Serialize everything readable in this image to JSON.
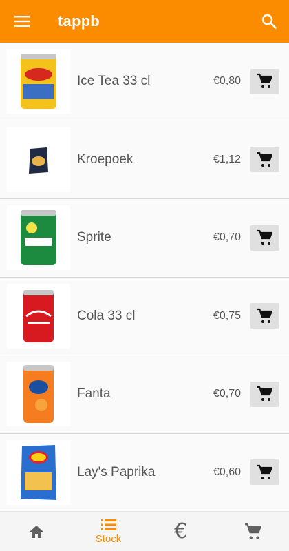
{
  "app": {
    "title": "tappb",
    "accent": "#fb8c00",
    "icons": {
      "menu": "menu-icon",
      "search": "search-icon"
    }
  },
  "products": [
    {
      "name": "Ice Tea 33 cl",
      "price": "€0,80",
      "image": "ice-tea-can-image",
      "color": "#f3c21b"
    },
    {
      "name": "Kroepoek",
      "price": "€1,12",
      "image": "kroepoek-bag-image",
      "color": "#1f2a44"
    },
    {
      "name": "Sprite",
      "price": "€0,70",
      "image": "sprite-can-image",
      "color": "#1c8a3f"
    },
    {
      "name": "Cola 33 cl",
      "price": "€0,75",
      "image": "cola-can-image",
      "color": "#d71920"
    },
    {
      "name": "Fanta",
      "price": "€0,70",
      "image": "fanta-can-image",
      "color": "#f57c1f"
    },
    {
      "name": "Lay's Paprika",
      "price": "€0,60",
      "image": "lays-paprika-bag-image",
      "color": "#2a6fd0"
    }
  ],
  "bottom_nav": [
    {
      "key": "home",
      "label": "",
      "icon": "home-icon",
      "active": false
    },
    {
      "key": "stock",
      "label": "Stock",
      "icon": "list-icon",
      "active": true
    },
    {
      "key": "payments",
      "label": "",
      "icon": "euro-icon",
      "active": false
    },
    {
      "key": "cart",
      "label": "",
      "icon": "cart-icon",
      "active": false
    }
  ]
}
